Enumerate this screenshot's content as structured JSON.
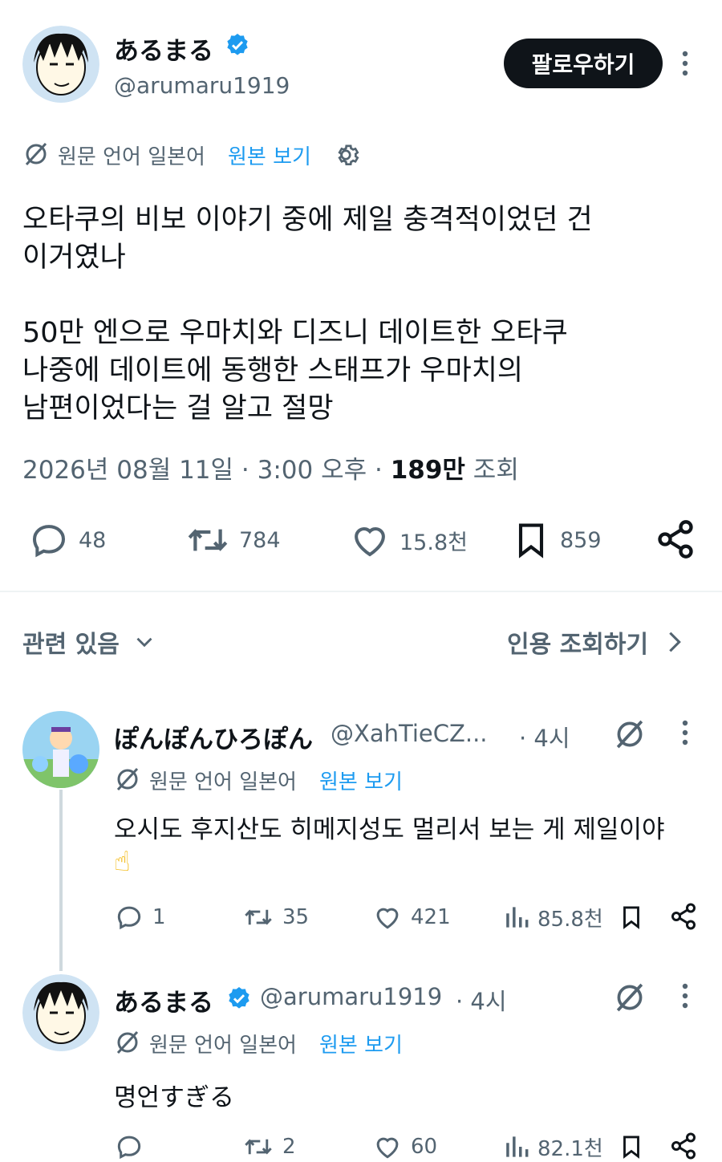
{
  "main_post": {
    "author_name": "あるまる",
    "handle": "@arumaru1919",
    "follow_label": "팔로우하기",
    "translation_lang": "원문 언어 일본어",
    "show_original": "원본 보기",
    "text_line1": "오타쿠의 비보 이야기 중에 제일 충격적이었던 건",
    "text_line2": "이거였나",
    "text_line3": "50만 엔으로 우마치와 디즈니 데이트한 오타쿠",
    "text_line4": "나중에 데이트에 동행한 스태프가 우마치의",
    "text_line5": "남편이었다는 걸 알고 절망",
    "timestamp": "2026년 08월 11일 · 3:00 오후 ·",
    "views_count": "189만",
    "views_label": "조회",
    "replies": "48",
    "reposts": "784",
    "likes": "15.8천",
    "bookmarks": "859"
  },
  "related": {
    "label": "관련 있음",
    "quote_label": "인용 조회하기"
  },
  "replies": [
    {
      "author_name": "ぽんぽんひろぽん",
      "handle": "@XahTieCZ...",
      "time": "· 4시",
      "translation_lang": "원문 언어 일본어",
      "show_original": "원본 보기",
      "text": "오시도 후지산도 히메지성도 멀리서 보는 게 제일이야",
      "emoji": "☝",
      "replies": "1",
      "reposts": "35",
      "likes": "421",
      "views": "85.8천"
    },
    {
      "author_name": "あるまる",
      "handle": "@arumaru1919",
      "time": "· 4시",
      "translation_lang": "원문 언어 일본어",
      "show_original": "원본 보기",
      "text": "명언すぎる",
      "replies": "",
      "reposts": "2",
      "likes": "60",
      "views": "82.1천"
    }
  ],
  "colors": {
    "accent": "#1d9bf0",
    "text": "#0f1419",
    "muted": "#536471",
    "verified": "#1d9bf0"
  }
}
